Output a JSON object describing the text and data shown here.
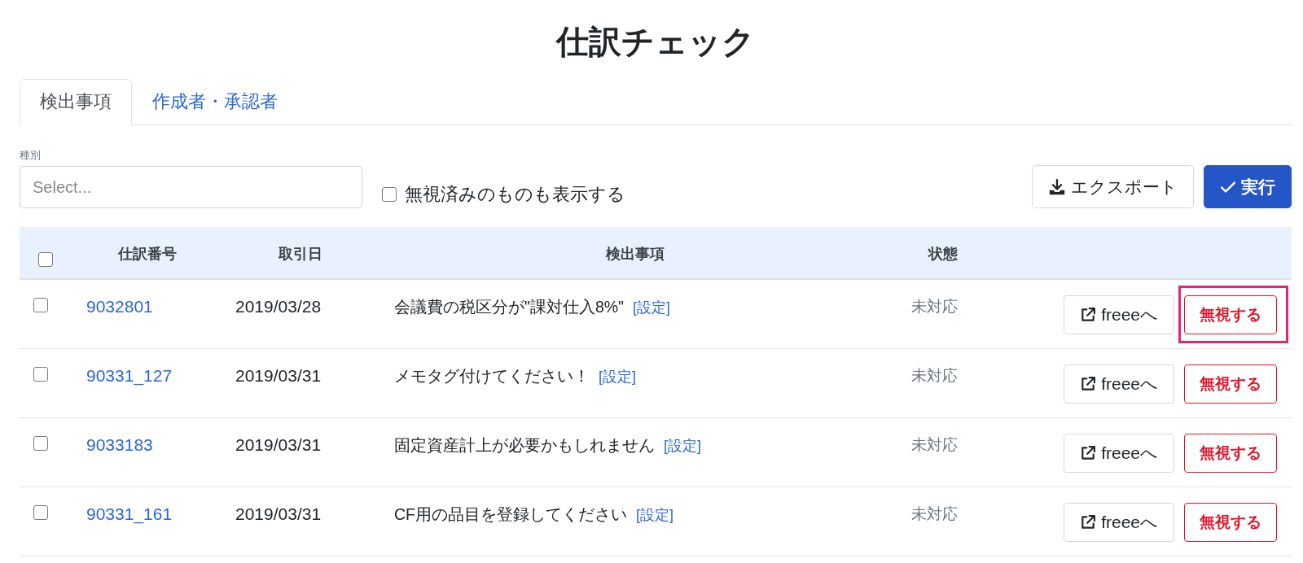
{
  "title": "仕訳チェック",
  "tabs": [
    {
      "label": "検出事項",
      "selected": true
    },
    {
      "label": "作成者・承認者",
      "selected": false
    }
  ],
  "filter": {
    "label": "種別",
    "placeholder": "Select..."
  },
  "show_ignored": {
    "label": "無視済みのものも表示する",
    "checked": false
  },
  "toolbar_buttons": [
    {
      "kind": "export",
      "label": "エクスポート"
    },
    {
      "kind": "run",
      "label": "実行"
    }
  ],
  "table": {
    "select_all_checked": false,
    "columns": [
      "仕訳番号",
      "取引日",
      "検出事項",
      "状態"
    ],
    "rows": [
      {
        "checked": false,
        "number": "9032801",
        "date": "2019/03/28",
        "issue": "会議費の税区分が\"課対仕入8%\"",
        "settings_link": "[設定]",
        "status": "未対応",
        "open_button": "freeeへ",
        "ignore_button": "無視する",
        "highlighted": true
      },
      {
        "checked": false,
        "number": "90331_127",
        "date": "2019/03/31",
        "issue": "メモタグ付けてください！",
        "settings_link": "[設定]",
        "status": "未対応",
        "open_button": "freeeへ",
        "ignore_button": "無視する",
        "highlighted": false
      },
      {
        "checked": false,
        "number": "9033183",
        "date": "2019/03/31",
        "issue": "固定資産計上が必要かもしれません",
        "settings_link": "[設定]",
        "status": "未対応",
        "open_button": "freeeへ",
        "ignore_button": "無視する",
        "highlighted": false
      },
      {
        "checked": false,
        "number": "90331_161",
        "date": "2019/03/31",
        "issue": "CF用の品目を登録してください",
        "settings_link": "[設定]",
        "status": "未対応",
        "open_button": "freeeへ",
        "ignore_button": "無視する",
        "highlighted": false
      }
    ]
  }
}
